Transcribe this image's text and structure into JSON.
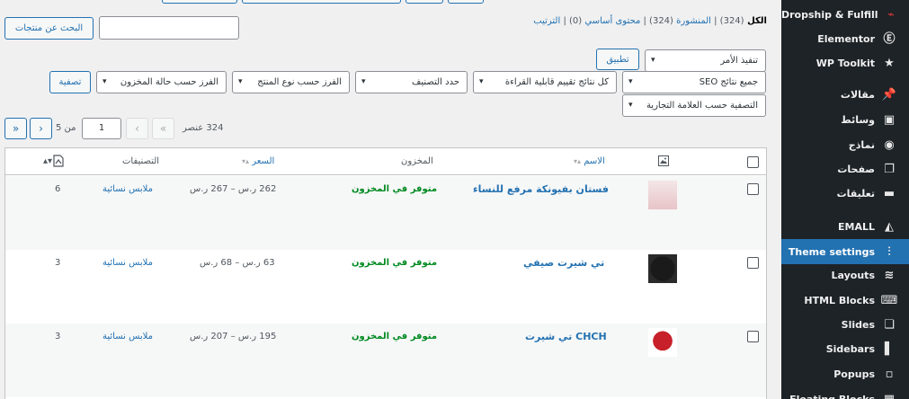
{
  "sidebar": {
    "items": [
      {
        "label": "Dropship & Fulfill",
        "icon": "dropship-icon",
        "glyph": "⌁"
      },
      {
        "label": "Elementor",
        "icon": "elementor-icon",
        "glyph": "Ⓔ"
      },
      {
        "label": "WP Toolkit",
        "icon": "star-icon",
        "glyph": "★"
      },
      {
        "label": "مقالات",
        "icon": "pin-icon",
        "glyph": "📌"
      },
      {
        "label": "وسائط",
        "icon": "media-icon",
        "glyph": "▣"
      },
      {
        "label": "نماذج",
        "icon": "forms-icon",
        "glyph": "◉"
      },
      {
        "label": "صفحات",
        "icon": "pages-icon",
        "glyph": "❐"
      },
      {
        "label": "تعليقات",
        "icon": "comments-icon",
        "glyph": "▬"
      },
      {
        "label": "EMALL",
        "icon": "emall-icon",
        "glyph": "◭"
      },
      {
        "label": "Theme settings",
        "icon": "sliders-icon",
        "glyph": "⫶"
      },
      {
        "label": "Layouts",
        "icon": "layers-icon",
        "glyph": "≋"
      },
      {
        "label": "HTML Blocks",
        "icon": "code-icon",
        "glyph": "⌨"
      },
      {
        "label": "Slides",
        "icon": "slides-icon",
        "glyph": "❏"
      },
      {
        "label": "Sidebars",
        "icon": "sidebar-icon",
        "glyph": "▌"
      },
      {
        "label": "Popups",
        "icon": "popup-icon",
        "glyph": "▫"
      },
      {
        "label": "Floating Blocks",
        "icon": "floating-icon",
        "glyph": "▦"
      }
    ],
    "active": "Theme settings"
  },
  "subsubsub": {
    "all": "الكل",
    "all_count": "(324)",
    "published": "المنشورة",
    "published_count": "(324)",
    "cornerstone": "محتوى أساسي",
    "cornerstone_count": "(0)",
    "sorting": "الترتيب",
    "sep": "|"
  },
  "search": {
    "button": "البحث عن منتجات",
    "value": ""
  },
  "bulk": {
    "select": "تنفيذ الأمر",
    "apply": "تطبيق"
  },
  "filters": {
    "seo": "جميع نتائج SEO",
    "readability": "كل نتائج تقييم قابلية القراءة",
    "category": "حدد التصنيف",
    "product_type": "الفرز حسب نوع المنتج",
    "stock_status": "الفرز حسب حالة المخزون",
    "brand": "التصفية حسب العلامة التجارية",
    "filter_button": "تصفية"
  },
  "pagination": {
    "count": "324 عنصر",
    "current": "1",
    "of": "من 5",
    "first": "«",
    "prev": "‹",
    "next": "›",
    "last": "»"
  },
  "table": {
    "headers": {
      "image": "image-icon",
      "name": "الاسم",
      "stock": "المخزون",
      "price": "السعر",
      "categories": "التصنيفات",
      "featured": "featured-icon"
    },
    "rows": [
      {
        "name": "فستان بفيونكة مرفع للنساء",
        "stock": "متوفر في المخزون",
        "price": "262 ر.س – 267 ر.س",
        "category": "ملابس نسائية",
        "num": "6",
        "thumb_color": "#e8c4c8"
      },
      {
        "name": "تي شيرت صيفي",
        "stock": "متوفر في المخزون",
        "price": "63 ر.س – 68 ر.س",
        "category": "ملابس نسائية",
        "num": "3",
        "thumb_color": "#1a1a1a"
      },
      {
        "name": "CHCH تي شيرت",
        "stock": "متوفر في المخزون",
        "price": "195 ر.س – 207 ر.س",
        "category": "ملابس نسائية",
        "num": "3",
        "thumb_color": "#c8202a"
      }
    ]
  }
}
